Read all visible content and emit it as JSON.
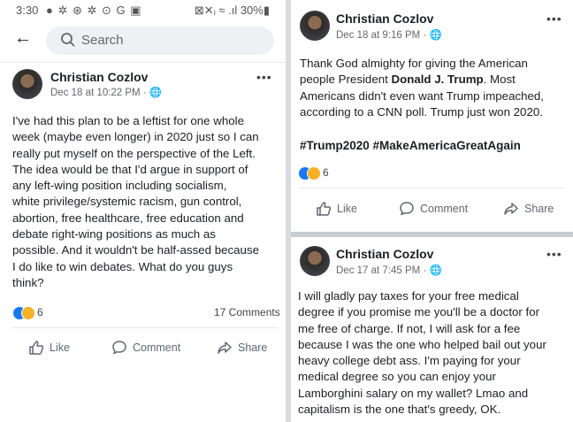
{
  "status_bar": {
    "time": "3:30",
    "icons": "● ✲ ⊛ ✲ ⊙ G ▣",
    "right": "⊠✕ᵢ ≈ .ıl 30%▮"
  },
  "search": {
    "placeholder": "Search"
  },
  "posts": [
    {
      "author": "Christian Cozlov",
      "meta": "Dec 18 at 10:22 PM · 🌐",
      "lines": [
        "I've had this plan to be a leftist for one whole",
        "week (maybe even longer) in 2020 just so I can",
        "really put myself on the perspective of the Left.",
        "The idea would be that I'd argue in support of",
        "any left-wing position including socialism,",
        "white privilege/systemic racism, gun control,",
        "abortion, free healthcare, free education and",
        "debate right-wing positions as much as",
        "possible. And it wouldn't be half-assed because",
        "I do like to win debates. What do you guys",
        "think?"
      ],
      "reaction_count": "6",
      "comments": "17 Comments"
    },
    {
      "author": "Christian Cozlov",
      "meta": "Dec 18 at 9:16 PM · 🌐",
      "line1": "Thank God almighty for giving the American",
      "line2_pre": "people President ",
      "line2_bold": "Donald J. Trump",
      "line2_post": ". Most",
      "line3": "Americans didn't even want Trump impeached,",
      "line4": "according to a CNN poll. Trump just won 2020.",
      "hashtags": "#Trump2020 #MakeAmericaGreatAgain",
      "reaction_count": "6"
    },
    {
      "author": "Christian Cozlov",
      "meta": "Dec 17 at 7:45 PM · 🌐",
      "lines": [
        "I will gladly pay taxes for your free medical",
        "degree if you promise me you'll be a doctor for",
        "me free of charge. If not, I will ask for a fee",
        "because I was the one who helped bail out your",
        "heavy college debt ass. I'm paying for your",
        "medical degree so you can enjoy your",
        "Lamborghini salary on my wallet? Lmao and",
        "capitalism is the one that's greedy, OK."
      ]
    }
  ],
  "actions": {
    "like": "Like",
    "comment": "Comment",
    "share": "Share"
  },
  "more": "•••"
}
